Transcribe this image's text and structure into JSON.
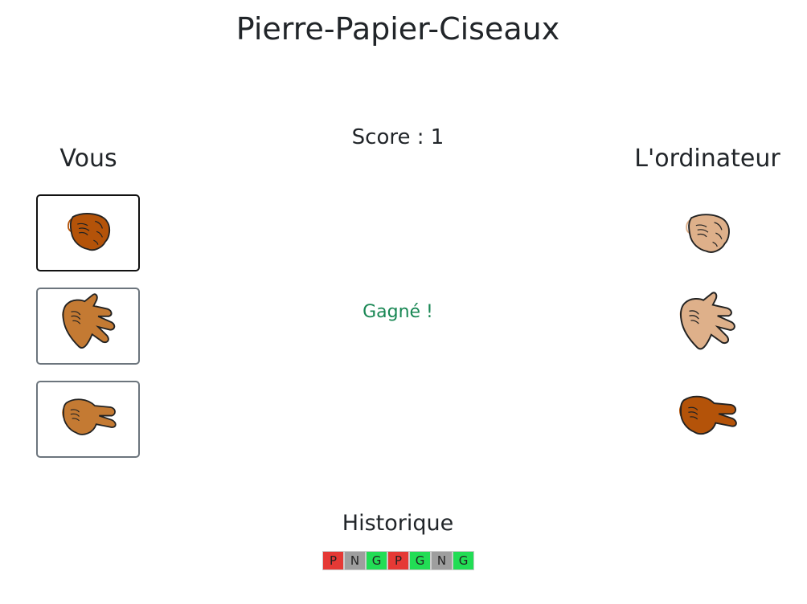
{
  "title": "Pierre-Papier-Ciseaux",
  "score": {
    "label": "Score",
    "separator": " : ",
    "value": "1"
  },
  "players": {
    "you": "Vous",
    "computer": "L'ordinateur"
  },
  "result": "Gagné !",
  "choices": {
    "player": [
      {
        "id": "rock",
        "icon": "rock-fist-icon",
        "selected": true
      },
      {
        "id": "paper",
        "icon": "paper-hand-icon",
        "selected": false
      },
      {
        "id": "scissors",
        "icon": "scissors-hand-icon",
        "selected": false
      }
    ],
    "computer": [
      {
        "id": "rock",
        "icon": "rock-fist-icon",
        "selected": false
      },
      {
        "id": "paper",
        "icon": "paper-hand-icon",
        "selected": false
      },
      {
        "id": "scissors",
        "icon": "scissors-hand-icon",
        "selected": true
      }
    ]
  },
  "history": {
    "title": "Historique",
    "entries": [
      "P",
      "N",
      "G",
      "P",
      "G",
      "N",
      "G"
    ]
  },
  "colors": {
    "win": "#22dd55",
    "lose": "#e53935",
    "draw": "#9e9e9e",
    "result_text": "#198754",
    "hand_selected": "#b45309",
    "hand_normal": "#c47a33",
    "hand_faded": "#deb08a"
  }
}
